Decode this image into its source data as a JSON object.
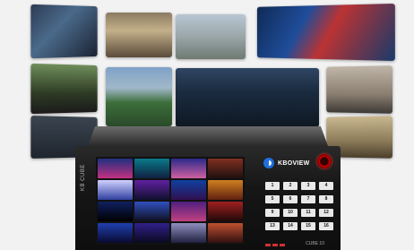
{
  "device": {
    "brand": "KBOVIEW",
    "model": "CUBE 10",
    "side_label": "KB CUBE",
    "keypad": [
      "1",
      "2",
      "3",
      "4",
      "5",
      "6",
      "7",
      "8",
      "9",
      "10",
      "11",
      "12",
      "13",
      "14",
      "15",
      "16"
    ]
  },
  "colors": {
    "background": "#f2f2f2",
    "device_body": "#161616",
    "power": "#cc0000",
    "logo": "#1e6fe0"
  }
}
